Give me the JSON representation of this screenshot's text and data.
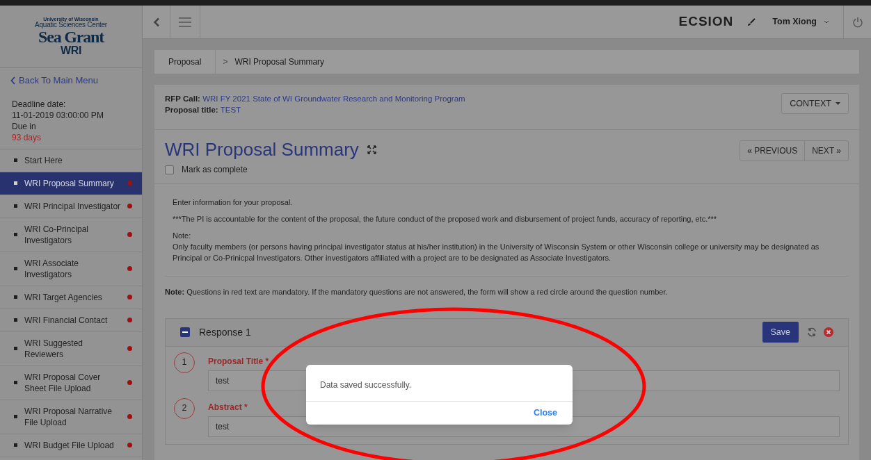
{
  "logo": {
    "lines": [
      "University of Wisconsin",
      "Aquatic Sciences Center",
      "Sea Grant",
      "WRI"
    ]
  },
  "sidebar": {
    "back_link": "Back To Main Menu",
    "deadline_label": "Deadline date:",
    "deadline": "11-01-2019 03:00:00 PM",
    "due_label": "Due in",
    "due": "93 days",
    "items": [
      {
        "label": "Start Here",
        "selected": false,
        "incomplete": false
      },
      {
        "label": "WRI Proposal Summary",
        "selected": true,
        "incomplete": true
      },
      {
        "label": "WRI Principal Investigator",
        "selected": false,
        "incomplete": true
      },
      {
        "label": "WRI Co-Principal Investigators",
        "selected": false,
        "incomplete": true
      },
      {
        "label": "WRI Associate Investigators",
        "selected": false,
        "incomplete": true
      },
      {
        "label": "WRI Target Agencies",
        "selected": false,
        "incomplete": true
      },
      {
        "label": "WRI Financial Contact",
        "selected": false,
        "incomplete": true
      },
      {
        "label": "WRI Suggested Reviewers",
        "selected": false,
        "incomplete": true
      },
      {
        "label": "WRI Proposal Cover Sheet File Upload",
        "selected": false,
        "incomplete": true
      },
      {
        "label": "WRI Proposal Narrative File Upload",
        "selected": false,
        "incomplete": true
      },
      {
        "label": "WRI Budget File Upload",
        "selected": false,
        "incomplete": true
      }
    ]
  },
  "topbar": {
    "brand": "ECSION",
    "user": "Tom Xiong"
  },
  "breadcrumb": {
    "items": [
      "Proposal",
      "WRI Proposal Summary"
    ],
    "separator": ">"
  },
  "header": {
    "rfp_label": "RFP Call:",
    "rfp": "WRI FY 2021 State of WI Groundwater Research and Monitoring Program",
    "title_label": "Proposal title:",
    "title": "TEST",
    "context_button": "CONTEXT"
  },
  "page": {
    "title": "WRI Proposal Summary",
    "mark_complete": "Mark as complete",
    "complete": false,
    "previous": "« PREVIOUS",
    "next": "NEXT »"
  },
  "intro": [
    "Enter information for your proposal.",
    "***The PI is accountable for the content of the proposal, the future conduct of the proposed work and disbursement of project funds, accuracy of reporting, etc.***",
    "Note:",
    "Only faculty members (or persons having principal investigator status at his/her institution) in the University of Wisconsin System or other Wisconsin college or university may be designated as Principal or Co-Prinicpal Investigators. Other investigators affiliated with a project are to be designated as Associate Investigators."
  ],
  "mandatory_note": "**Note:** Questions in red text are mandatory. If the mandatory questions are not answered, the form will show a red circle around the question number.",
  "response": {
    "title": "Response 1",
    "save": "Save",
    "questions": [
      {
        "number": "1",
        "label": "Proposal Title *",
        "required": true,
        "value": "test"
      },
      {
        "number": "2",
        "label": "Abstract *",
        "required": true,
        "value": "test"
      }
    ]
  },
  "dialog": {
    "message": "Data saved successfully.",
    "close": "Close"
  }
}
